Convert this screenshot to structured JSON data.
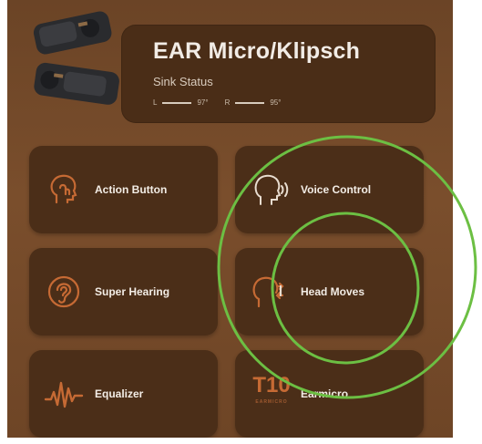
{
  "device": {
    "name": "EAR Micro/Klipsch",
    "status": "Sink Status",
    "left_label": "L",
    "left_value": "97°",
    "right_label": "R",
    "right_value": "95°"
  },
  "tiles": [
    {
      "label": "Action Button",
      "icon": "head-touch-icon"
    },
    {
      "label": "Voice Control",
      "icon": "head-voice-icon"
    },
    {
      "label": "Super Hearing",
      "icon": "ear-icon"
    },
    {
      "label": "Head Moves",
      "icon": "head-move-icon"
    },
    {
      "label": "Equalizer",
      "icon": "waveform-icon"
    },
    {
      "label": "Earmicro",
      "icon": "t10-logo",
      "logo_text": "T10",
      "logo_sub": "EARMICRO"
    }
  ],
  "colors": {
    "background": "#7a4e2c",
    "card": "#4b2e18",
    "icon_accent": "#c66a34",
    "annotation": "#6cbf43"
  }
}
